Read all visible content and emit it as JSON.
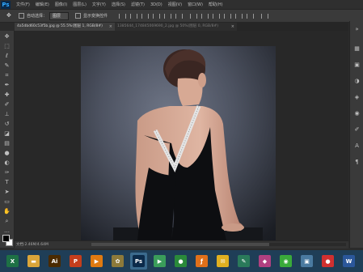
{
  "app": {
    "logo": "Ps"
  },
  "menubar": {
    "items": [
      "文件(F)",
      "编辑(E)",
      "图像(I)",
      "图层(L)",
      "文字(Y)",
      "选择(S)",
      "滤镜(T)",
      "3D(D)",
      "视图(V)",
      "窗口(W)",
      "帮助(H)"
    ]
  },
  "options": {
    "auto_select_label": "自动选择：",
    "auto_select_value": "图层",
    "show_transform_label": "显示变换控件"
  },
  "tabs": [
    {
      "label": "4a5dbd60c53f5b.jpg @ 55.5%(图层 1, RGB/8#)"
    },
    {
      "label": "1385644_174845069690_2.jpg @ 50%(图层 0, RGB/8#)"
    }
  ],
  "status": {
    "text": "文档:2.46M/4.64M"
  },
  "tools": [
    "move",
    "marquee",
    "lasso",
    "quick-select",
    "crop",
    "eyedropper",
    "healing",
    "brush",
    "stamp",
    "history-brush",
    "eraser",
    "gradient",
    "blur",
    "dodge",
    "pen",
    "type",
    "path-select",
    "shape",
    "hand",
    "zoom",
    "more"
  ],
  "taskbar": {
    "items": [
      {
        "name": "excel-icon",
        "glyph": "X",
        "color": "#1e7145"
      },
      {
        "name": "folder-icon",
        "glyph": "▬",
        "color": "#d9a53a"
      },
      {
        "name": "illustrator-icon",
        "glyph": "Ai",
        "color": "#4a2a00"
      },
      {
        "name": "powerpoint-icon",
        "glyph": "P",
        "color": "#c43e1c"
      },
      {
        "name": "media-player-icon",
        "glyph": "▶",
        "color": "#e07a10"
      },
      {
        "name": "pictures-icon",
        "glyph": "✿",
        "color": "#8d7a3a"
      },
      {
        "name": "photoshop-icon",
        "glyph": "Ps",
        "color": "#0b2a4a",
        "active": true
      },
      {
        "name": "play-store-icon",
        "glyph": "▶",
        "color": "#3a9d5a"
      },
      {
        "name": "globe-icon",
        "glyph": "●",
        "color": "#2a8a3a"
      },
      {
        "name": "flash-icon",
        "glyph": "ƒ",
        "color": "#e0701a"
      },
      {
        "name": "chat-icon",
        "glyph": "✉",
        "color": "#e0b020"
      },
      {
        "name": "pen-app-icon",
        "glyph": "✎",
        "color": "#2a7a5a"
      },
      {
        "name": "color-picker-icon",
        "glyph": "◆",
        "color": "#b04080"
      },
      {
        "name": "green-circle-icon",
        "glyph": "◉",
        "color": "#3aaa3a"
      },
      {
        "name": "image-viewer-icon",
        "glyph": "▣",
        "color": "#4a7aa0"
      },
      {
        "name": "red-app-icon",
        "glyph": "●",
        "color": "#d03030"
      },
      {
        "name": "word-icon",
        "glyph": "W",
        "color": "#2b579a"
      }
    ]
  },
  "colors": {
    "accent": "#31a8ff",
    "taskbar": "#1f3e57"
  }
}
